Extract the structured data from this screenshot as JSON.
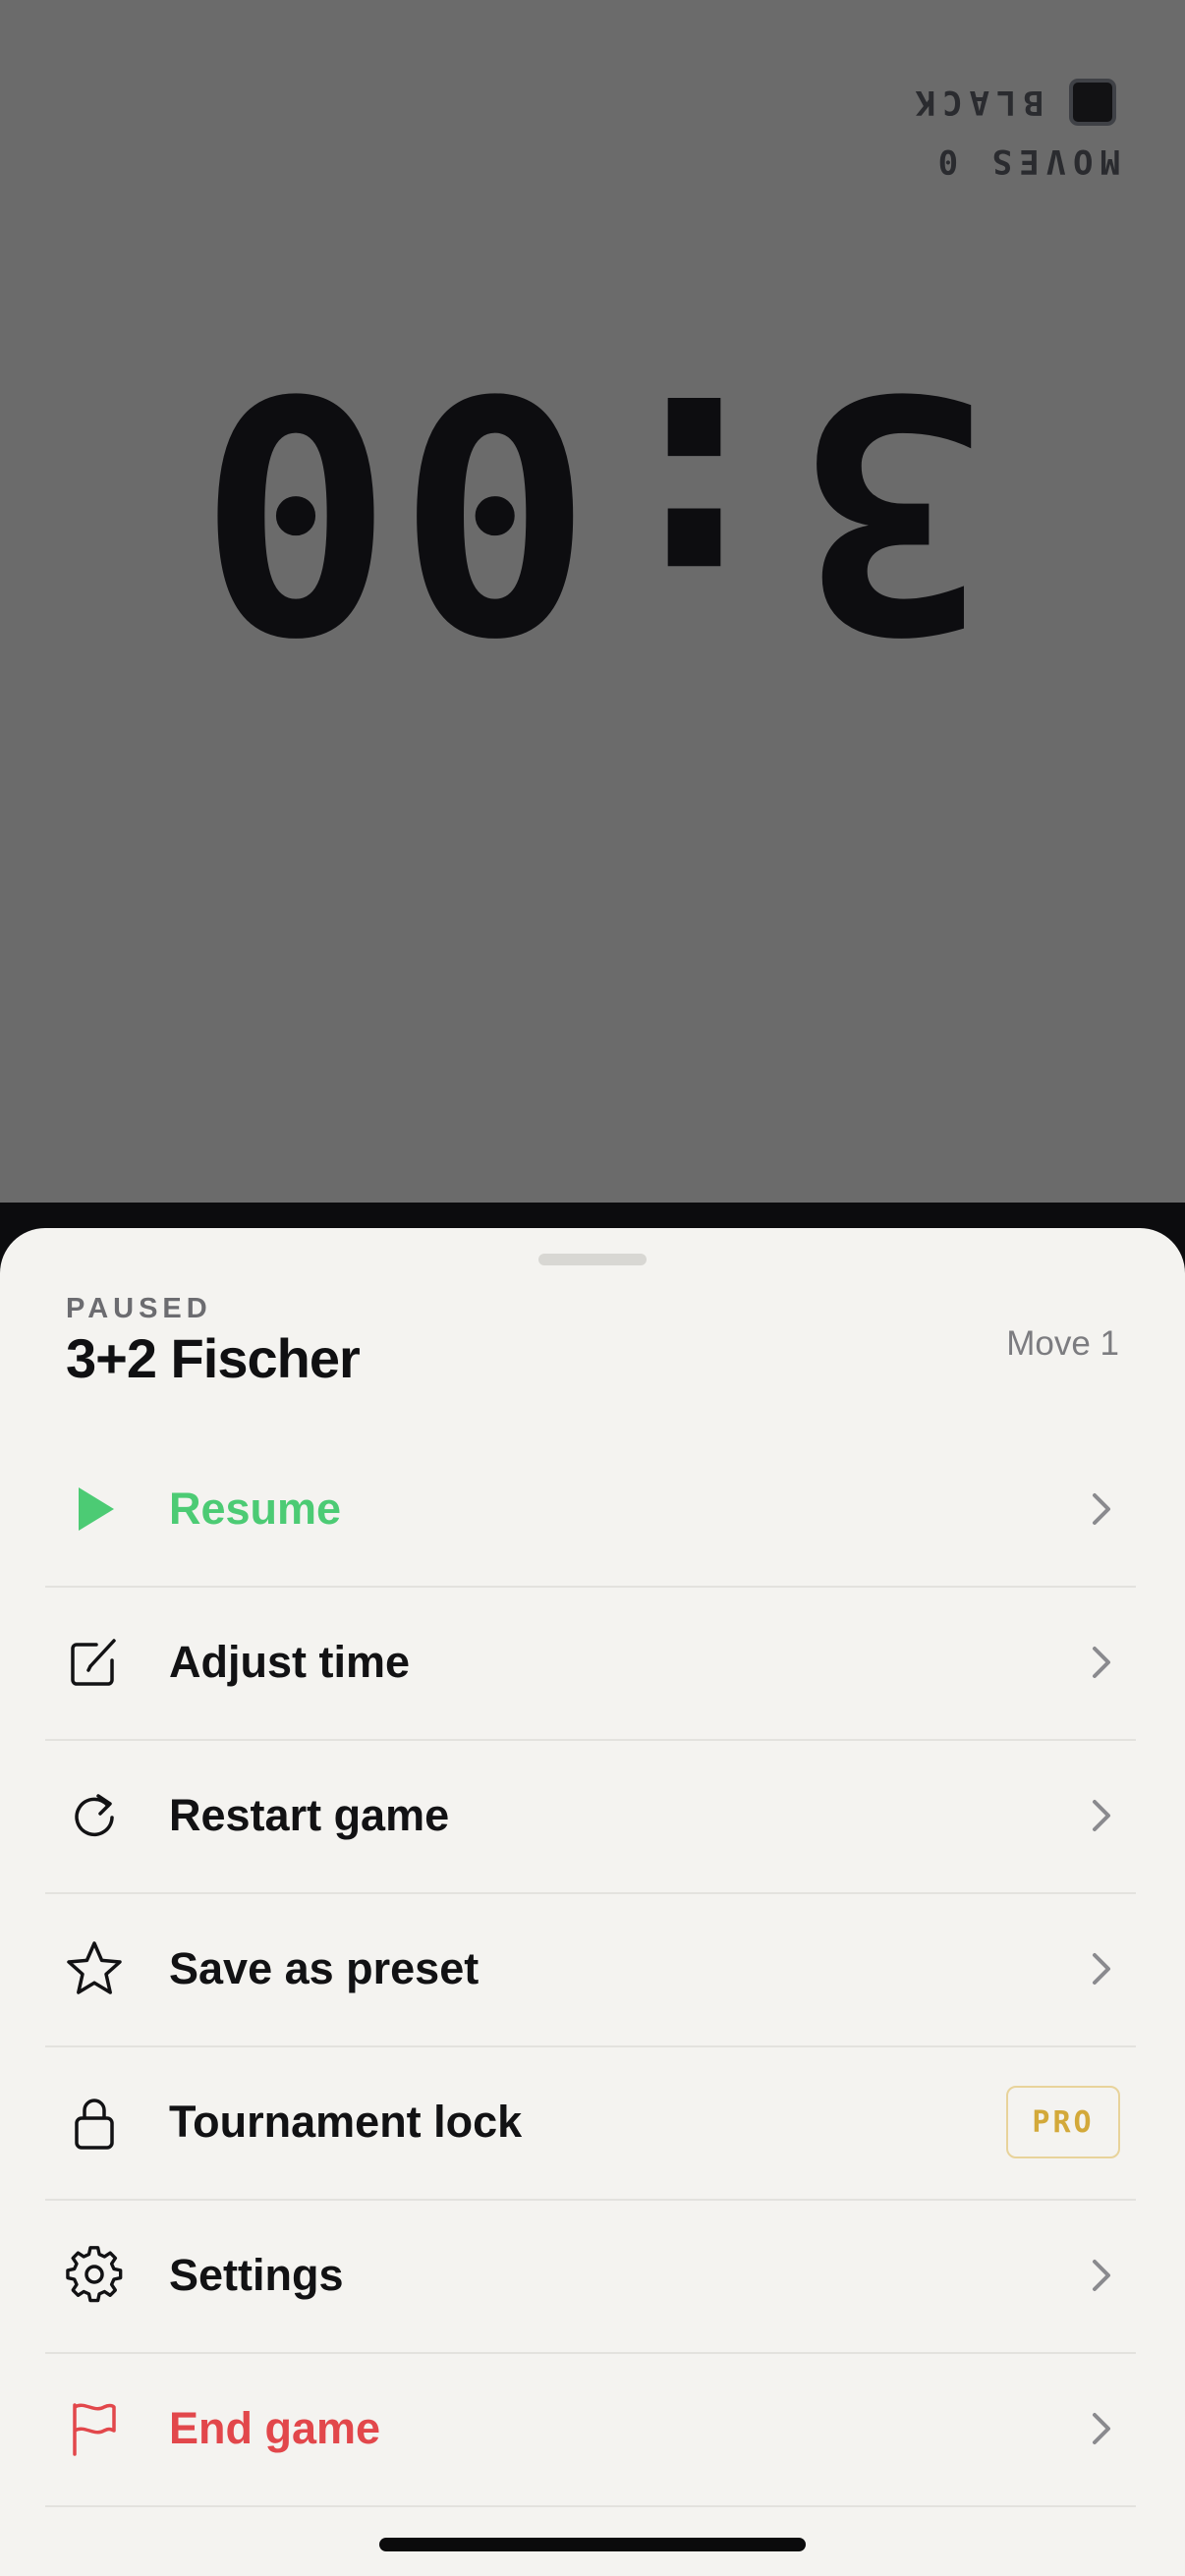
{
  "opponent_clock": {
    "moves_label": "MOVES 0",
    "time": "3:00",
    "player_label": "BLACK"
  },
  "sheet": {
    "status": "PAUSED",
    "title": "3+2 Fischer",
    "move_count": "Move 1"
  },
  "menu": {
    "items": [
      {
        "label": "Resume",
        "icon": "play-icon",
        "color": "#4ccb74"
      },
      {
        "label": "Adjust time",
        "icon": "edit-icon"
      },
      {
        "label": "Restart game",
        "icon": "restart-icon"
      },
      {
        "label": "Save as preset",
        "icon": "star-icon"
      },
      {
        "label": "Tournament lock",
        "icon": "lock-icon",
        "badge": "PRO"
      },
      {
        "label": "Settings",
        "icon": "gear-icon"
      },
      {
        "label": "End game",
        "icon": "flag-icon",
        "color": "#e2474b"
      }
    ]
  },
  "colors": {
    "panel": "#6b6b6b",
    "sheet": "#f4f3f0",
    "accent_green": "#4ccb74",
    "accent_red": "#e2474b",
    "pro_gold": "#d3a93a"
  }
}
